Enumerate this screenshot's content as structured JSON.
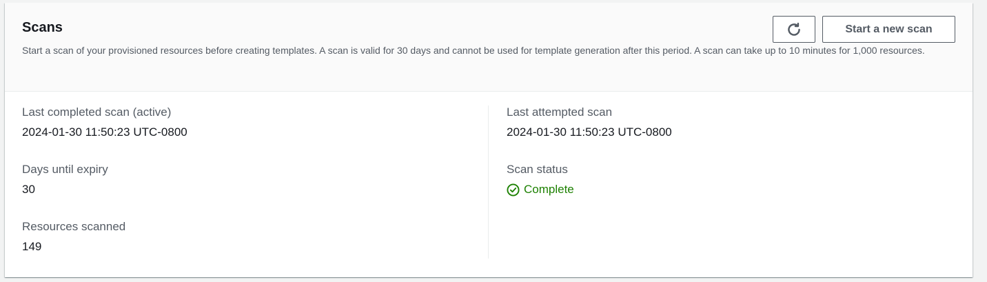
{
  "header": {
    "title": "Scans",
    "description": "Start a scan of your provisioned resources before creating templates. A scan is valid for 30 days and cannot be used for template generation after this period. A scan can take up to 10 minutes for 1,000 resources.",
    "refresh_icon": "refresh-icon",
    "start_scan_label": "Start a new scan"
  },
  "details": {
    "left": [
      {
        "label": "Last completed scan (active)",
        "value": "2024-01-30 11:50:23 UTC-0800"
      },
      {
        "label": "Days until expiry",
        "value": "30"
      },
      {
        "label": "Resources scanned",
        "value": "149"
      }
    ],
    "right": [
      {
        "label": "Last attempted scan",
        "value": "2024-01-30 11:50:23 UTC-0800"
      },
      {
        "label": "Scan status",
        "value": "Complete",
        "icon": "status-success-icon"
      }
    ]
  },
  "colors": {
    "success": "#1d8102",
    "label": "#545b64",
    "text": "#16191f"
  }
}
